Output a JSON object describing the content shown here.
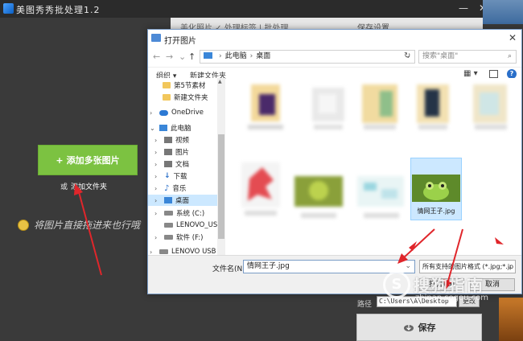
{
  "app": {
    "title": "美图秀秀批处理1.2",
    "min_glyph": "—",
    "close_glyph": "✕",
    "tab_left": "美化照片",
    "tab_left_extra": "  ✓ 处理标签 | 批处理",
    "tab_right": "保存设置",
    "add_button": "添加多张图片",
    "add_glyph": "+",
    "or_text": "或",
    "add_folder": "添加文件夹",
    "drag_hint": "将图片直接拖进来也行哦",
    "path_label": "路径",
    "path_value": "C:\\Users\\A\\Desktop",
    "change_button": "更改",
    "save_button": "保存"
  },
  "dialog": {
    "title": "打开图片",
    "close_glyph": "✕",
    "nav_back": "←",
    "nav_forward": "→",
    "nav_recent": "⌄",
    "nav_up": "↑",
    "breadcrumb": [
      "此电脑",
      "桌面"
    ],
    "breadcrumb_sep": "›",
    "dropdown_glyph": "⌄",
    "refresh_glyph": "↻",
    "search_placeholder": "搜索\"桌面\"",
    "search_glyph": "⌕",
    "organize": "组织 ▾",
    "new_folder": "新建文件夹",
    "view_glyph": "▦ ▾",
    "help_glyph": "?",
    "scroll_up": "▲",
    "sidebar": [
      {
        "label": "第5节素材",
        "icon": "folder-icon",
        "level": 1
      },
      {
        "label": "新建文件夹",
        "icon": "folder-icon",
        "level": 1
      },
      {
        "label": "OneDrive",
        "icon": "cloud-icon",
        "level": 0,
        "expander": "›"
      },
      {
        "label": "此电脑",
        "icon": "computer-icon",
        "level": 0,
        "expander": "⌄"
      },
      {
        "label": "视频",
        "icon": "video-icon",
        "level": 1,
        "expander": "›"
      },
      {
        "label": "图片",
        "icon": "pictures-icon",
        "level": 1,
        "expander": "›"
      },
      {
        "label": "文档",
        "icon": "documents-icon",
        "level": 1,
        "expander": "›"
      },
      {
        "label": "下载",
        "icon": "download-icon",
        "level": 1,
        "expander": "›"
      },
      {
        "label": "音乐",
        "icon": "music-icon",
        "level": 1,
        "expander": "›"
      },
      {
        "label": "桌面",
        "icon": "desktop-icon",
        "level": 1,
        "expander": "›",
        "selected": true
      },
      {
        "label": "系统 (C:)",
        "icon": "drive-icon",
        "level": 1,
        "expander": "›"
      },
      {
        "label": "LENOVO_USB_",
        "icon": "drive-icon",
        "level": 1,
        "expander": ""
      },
      {
        "label": "软件 (F:)",
        "icon": "drive-icon",
        "level": 1,
        "expander": "›"
      },
      {
        "label": "LENOVO USB H",
        "icon": "usb-drive-icon",
        "level": 0,
        "expander": "›"
      }
    ],
    "selected_file": "情网王子.jpg",
    "filename_label": "文件名(N):",
    "filename_value": "情网王子.jpg",
    "filetype": "所有支持的图片格式 (*.jpg;*.jp",
    "open_button": "打开(O)",
    "cancel_button": "取消"
  },
  "watermark": {
    "glyph": "S",
    "text": "搜狗指南",
    "url": "zhinan.sogou.com"
  },
  "colors": {
    "add_button": "#7cc241",
    "selection": "#cce8ff",
    "arrow": "#e0262b"
  }
}
